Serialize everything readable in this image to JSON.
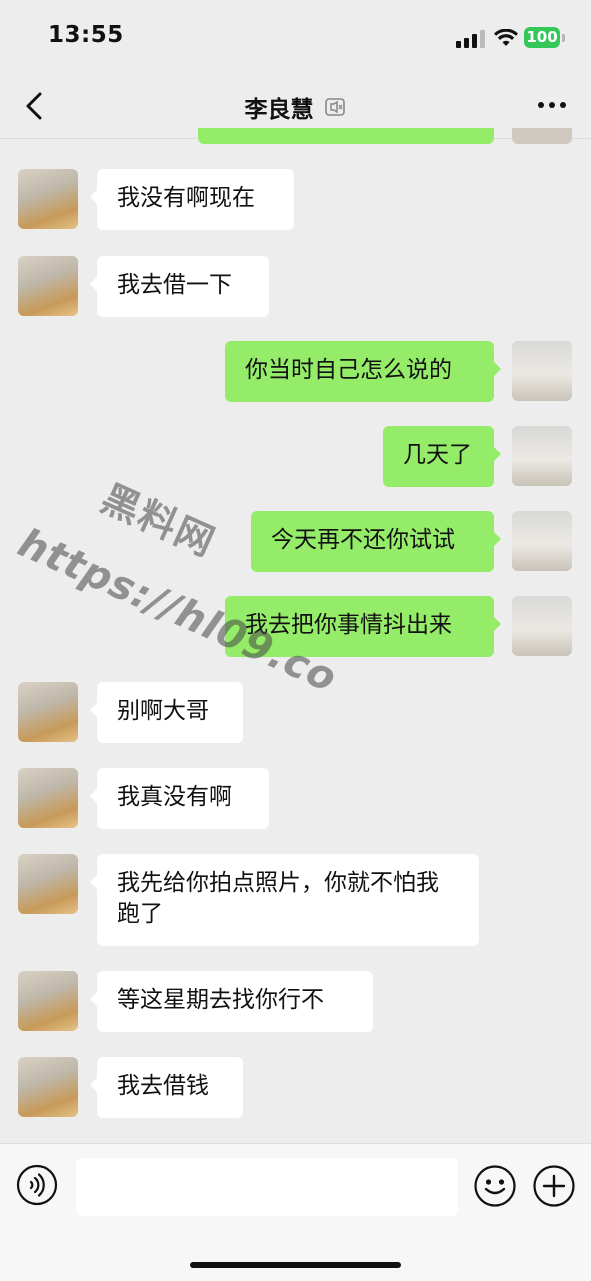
{
  "status_bar": {
    "time": "13:55",
    "battery": "100"
  },
  "header": {
    "title": "李良慧",
    "back_icon": "chevron-left-icon",
    "mute_icon": "mute-icon",
    "more_icon": "more-dots-icon"
  },
  "messages": [
    {
      "side": "in",
      "text": "我没有啊现在"
    },
    {
      "side": "in",
      "text": "我去借一下"
    },
    {
      "side": "out",
      "text": "你当时自己怎么说的"
    },
    {
      "side": "out",
      "text": "几天了"
    },
    {
      "side": "out",
      "text": "今天再不还你试试"
    },
    {
      "side": "out",
      "text": "我去把你事情抖出来"
    },
    {
      "side": "in",
      "text": "别啊大哥"
    },
    {
      "side": "in",
      "text": "我真没有啊"
    },
    {
      "side": "in",
      "text": "我先给你拍点照片，你就不怕我跑了"
    },
    {
      "side": "in",
      "text": "等这星期去找你行不"
    },
    {
      "side": "in",
      "text": "我去借钱"
    }
  ],
  "watermark": {
    "line1": "黑料网",
    "line2": "https://hl09.co"
  },
  "input_bar": {
    "value": "",
    "voice_icon": "voice-icon",
    "emoji_icon": "emoji-icon",
    "plus_icon": "plus-icon"
  },
  "colors": {
    "outgoing_bubble": "#95ec69",
    "incoming_bubble": "#ffffff",
    "background": "#ededed"
  }
}
